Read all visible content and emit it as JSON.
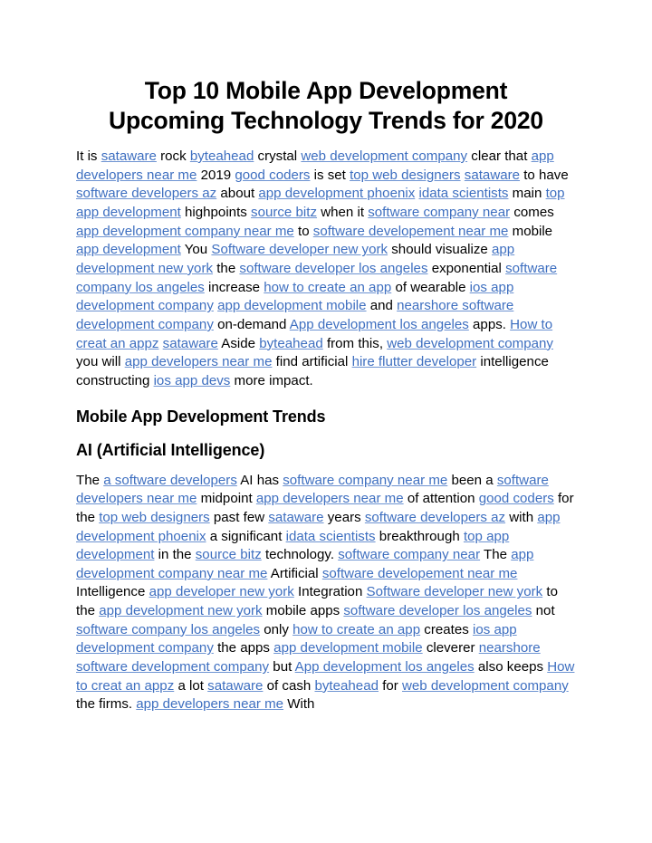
{
  "document": {
    "title": "Top 10 Mobile App Development Upcoming Technology Trends for 2020",
    "title_line_1": "Top 10 Mobile App Development",
    "title_line_2": "Upcoming Technology Trends for 2020"
  },
  "colors": {
    "link": "#3e6fc0",
    "link_underline": "#6d93d2",
    "text": "#000000",
    "background": "#ffffff"
  },
  "headings": {
    "section_1": "Mobile App Development Trends",
    "section_2": "AI (Artificial Intelligence)"
  },
  "paragraphs": [
    {
      "id": "intro-paragraph",
      "runs": [
        {
          "t": "It is ",
          "link": false
        },
        {
          "t": "sataware",
          "link": true
        },
        {
          "t": " rock ",
          "link": false
        },
        {
          "t": "byteahead",
          "link": true
        },
        {
          "t": " crystal ",
          "link": false
        },
        {
          "t": "web development company",
          "link": true
        },
        {
          "t": " clear that ",
          "link": false
        },
        {
          "t": "app developers near me",
          "link": true
        },
        {
          "t": " 2019 ",
          "link": false
        },
        {
          "t": "good coders",
          "link": true
        },
        {
          "t": " is set ",
          "link": false
        },
        {
          "t": "top web designers",
          "link": true
        },
        {
          "t": " ",
          "link": false
        },
        {
          "t": "sataware",
          "link": true
        },
        {
          "t": " to have ",
          "link": false
        },
        {
          "t": "software developers az",
          "link": true
        },
        {
          "t": " about ",
          "link": false
        },
        {
          "t": "app development phoenix",
          "link": true
        },
        {
          "t": " ",
          "link": false
        },
        {
          "t": "idata scientists",
          "link": true
        },
        {
          "t": " main ",
          "link": false
        },
        {
          "t": "top app development",
          "link": true
        },
        {
          "t": " highpoints ",
          "link": false
        },
        {
          "t": "source bitz",
          "link": true
        },
        {
          "t": " when it ",
          "link": false
        },
        {
          "t": "software company near",
          "link": true
        },
        {
          "t": " comes ",
          "link": false
        },
        {
          "t": "app development company near me",
          "link": true
        },
        {
          "t": " to ",
          "link": false
        },
        {
          "t": "software developement near me",
          "link": true
        },
        {
          "t": " mobile ",
          "link": false
        },
        {
          "t": "app development",
          "link": true
        },
        {
          "t": " You ",
          "link": false
        },
        {
          "t": "Software developer new york",
          "link": true
        },
        {
          "t": " should visualize ",
          "link": false
        },
        {
          "t": "app development new york",
          "link": true
        },
        {
          "t": " the ",
          "link": false
        },
        {
          "t": "software developer los angeles",
          "link": true
        },
        {
          "t": " exponential ",
          "link": false
        },
        {
          "t": "software company los angeles",
          "link": true
        },
        {
          "t": " increase ",
          "link": false
        },
        {
          "t": "how to create an app",
          "link": true
        },
        {
          "t": " of wearable ",
          "link": false
        },
        {
          "t": "ios app development company",
          "link": true
        },
        {
          "t": " ",
          "link": false
        },
        {
          "t": "app development mobile",
          "link": true
        },
        {
          "t": " and ",
          "link": false
        },
        {
          "t": "nearshore software development company",
          "link": true
        },
        {
          "t": " on-demand ",
          "link": false
        },
        {
          "t": "App development los angeles",
          "link": true
        },
        {
          "t": " apps. ",
          "link": false
        },
        {
          "t": "How to creat an appz",
          "link": true
        },
        {
          "t": " ",
          "link": false
        },
        {
          "t": "sataware",
          "link": true
        },
        {
          "t": " Aside ",
          "link": false
        },
        {
          "t": "byteahead",
          "link": true
        },
        {
          "t": " from this, ",
          "link": false
        },
        {
          "t": "web development company",
          "link": true
        },
        {
          "t": " you will ",
          "link": false
        },
        {
          "t": "app developers near me",
          "link": true
        },
        {
          "t": " find artificial ",
          "link": false
        },
        {
          "t": "hire flutter developer",
          "link": true
        },
        {
          "t": " intelligence constructing ",
          "link": false
        },
        {
          "t": "ios app devs",
          "link": true
        },
        {
          "t": " more impact.",
          "link": false
        }
      ]
    },
    {
      "id": "ai-paragraph",
      "runs": [
        {
          "t": "The ",
          "link": false
        },
        {
          "t": "a software developers",
          "link": true
        },
        {
          "t": " AI has ",
          "link": false
        },
        {
          "t": "software company near me",
          "link": true
        },
        {
          "t": " been a ",
          "link": false
        },
        {
          "t": "software developers near me",
          "link": true
        },
        {
          "t": " midpoint ",
          "link": false
        },
        {
          "t": "app developers near me",
          "link": true
        },
        {
          "t": " of attention ",
          "link": false
        },
        {
          "t": "good coders",
          "link": true
        },
        {
          "t": " for the ",
          "link": false
        },
        {
          "t": "top web designers",
          "link": true
        },
        {
          "t": " past few ",
          "link": false
        },
        {
          "t": "sataware",
          "link": true
        },
        {
          "t": " years ",
          "link": false
        },
        {
          "t": "software developers az",
          "link": true
        },
        {
          "t": " with ",
          "link": false
        },
        {
          "t": "app development phoenix",
          "link": true
        },
        {
          "t": " a significant ",
          "link": false
        },
        {
          "t": "idata scientists",
          "link": true
        },
        {
          "t": " breakthrough ",
          "link": false
        },
        {
          "t": "top app development",
          "link": true
        },
        {
          "t": " in the ",
          "link": false
        },
        {
          "t": "source bitz",
          "link": true
        },
        {
          "t": " technology. ",
          "link": false
        },
        {
          "t": "software company near",
          "link": true
        },
        {
          "t": " The ",
          "link": false
        },
        {
          "t": "app development company near me",
          "link": true
        },
        {
          "t": " Artificial ",
          "link": false
        },
        {
          "t": "software developement near me",
          "link": true
        },
        {
          "t": " Intelligence ",
          "link": false
        },
        {
          "t": "app developer new york",
          "link": true
        },
        {
          "t": " Integration ",
          "link": false
        },
        {
          "t": "Software developer new york",
          "link": true
        },
        {
          "t": " to the ",
          "link": false
        },
        {
          "t": "app development new york",
          "link": true
        },
        {
          "t": " mobile apps ",
          "link": false
        },
        {
          "t": "software developer los angeles",
          "link": true
        },
        {
          "t": " not ",
          "link": false
        },
        {
          "t": "software company los angeles",
          "link": true
        },
        {
          "t": " only ",
          "link": false
        },
        {
          "t": "how to create an app",
          "link": true
        },
        {
          "t": " creates ",
          "link": false
        },
        {
          "t": "ios app development company",
          "link": true
        },
        {
          "t": " the apps ",
          "link": false
        },
        {
          "t": "app development mobile",
          "link": true
        },
        {
          "t": " cleverer ",
          "link": false
        },
        {
          "t": "nearshore software development company",
          "link": true
        },
        {
          "t": " but ",
          "link": false
        },
        {
          "t": "App development los angeles",
          "link": true
        },
        {
          "t": " also keeps ",
          "link": false
        },
        {
          "t": "How to creat an appz",
          "link": true
        },
        {
          "t": " a lot ",
          "link": false
        },
        {
          "t": "sataware",
          "link": true
        },
        {
          "t": " of cash ",
          "link": false
        },
        {
          "t": "byteahead",
          "link": true
        },
        {
          "t": " for ",
          "link": false
        },
        {
          "t": "web development company",
          "link": true
        },
        {
          "t": " the firms. ",
          "link": false
        },
        {
          "t": "app developers near me",
          "link": true
        },
        {
          "t": " With",
          "link": false
        }
      ]
    }
  ]
}
